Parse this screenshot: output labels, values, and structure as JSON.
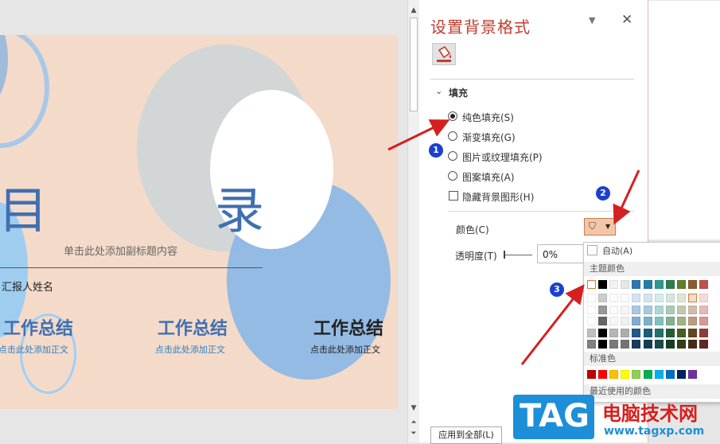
{
  "slide": {
    "char_mu": "目",
    "char_lu": "录",
    "subtitle_placeholder": "单击此处添加副标题内容",
    "reporter": "汇报人姓名",
    "blocks": [
      {
        "title": "工作总结",
        "body": "点击此处添加正文"
      },
      {
        "title": "工作总结",
        "body": "点击此处添加正文"
      },
      {
        "title": "工作总结",
        "body": "点击此处添加正文"
      }
    ]
  },
  "pane": {
    "title": "设置背景格式",
    "section_fill": "填充",
    "options": [
      "纯色填充(S)",
      "渐变填充(G)",
      "图片或纹理填充(P)",
      "图案填充(A)"
    ],
    "selected_option": "纯色填充(S)",
    "hide_bg_graphics": "隐藏背景图形(H)",
    "color_label": "颜色(C)",
    "transparency_label": "透明度(T)",
    "transparency_value": "0%",
    "apply_all_button": "应用到全部(L)"
  },
  "color_dropdown": {
    "auto_label": "自动(A)",
    "theme_colors_label": "主题颜色",
    "standard_colors_label": "标准色",
    "recent_colors_label": "最近使用的颜色",
    "theme_colors": [
      "#ffffff",
      "#000000",
      "#f2f2f2",
      "#e7e6e6",
      "#2e75b6",
      "#1f7ea5",
      "#2a9a8f",
      "#2d7c4a",
      "#5f7e2f",
      "#8b5a2b",
      "#c0504d"
    ],
    "standard_colors": [
      "#c00000",
      "#ff0000",
      "#ffc000",
      "#ffff00",
      "#92d050",
      "#00b050",
      "#00b0f0",
      "#0070c0",
      "#002060",
      "#7030a0"
    ]
  },
  "badges": [
    "1",
    "2",
    "3"
  ],
  "watermark": {
    "logo_text": "TAG",
    "site_name": "电脑技术网",
    "url": "www.tagxp.com"
  },
  "accent_color": "#c23d2e"
}
